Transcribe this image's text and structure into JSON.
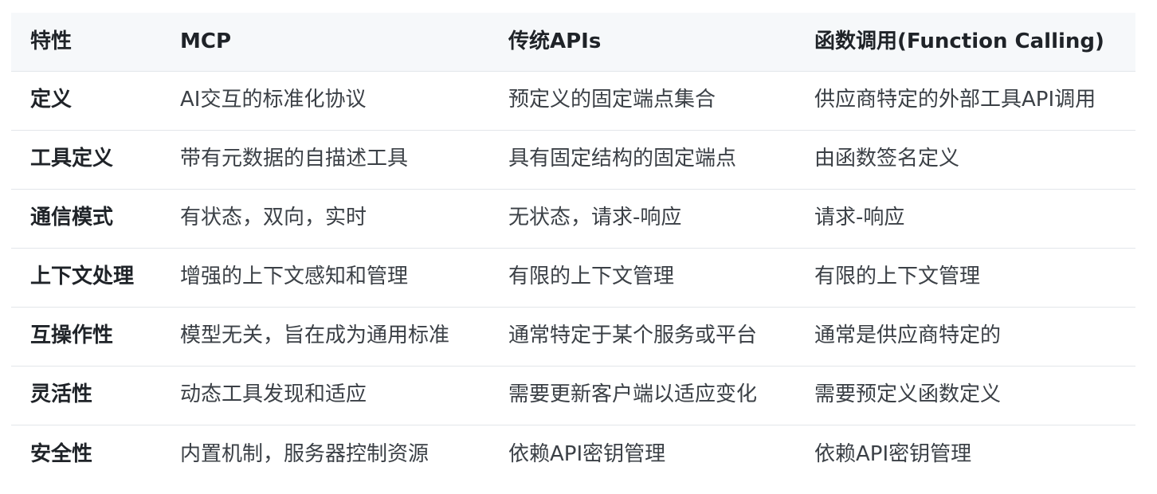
{
  "table": {
    "headers": [
      "特性",
      "MCP",
      "传统APIs",
      "函数调用(Function Calling)"
    ],
    "rows": [
      [
        "定义",
        "AI交互的标准化协议",
        "预定义的固定端点集合",
        "供应商特定的外部工具API调用"
      ],
      [
        "工具定义",
        "带有元数据的自描述工具",
        "具有固定结构的固定端点",
        "由函数签名定义"
      ],
      [
        "通信模式",
        "有状态，双向，实时",
        "无状态，请求-响应",
        "请求-响应"
      ],
      [
        "上下文处理",
        "增强的上下文感知和管理",
        "有限的上下文管理",
        "有限的上下文管理"
      ],
      [
        "互操作性",
        "模型无关，旨在成为通用标准",
        "通常特定于某个服务或平台",
        "通常是供应商特定的"
      ],
      [
        "灵活性",
        "动态工具发现和适应",
        "需要更新客户端以适应变化",
        "需要预定义函数定义"
      ],
      [
        "安全性",
        "内置机制，服务器控制资源",
        "依赖API密钥管理",
        "依赖API密钥管理"
      ]
    ]
  }
}
